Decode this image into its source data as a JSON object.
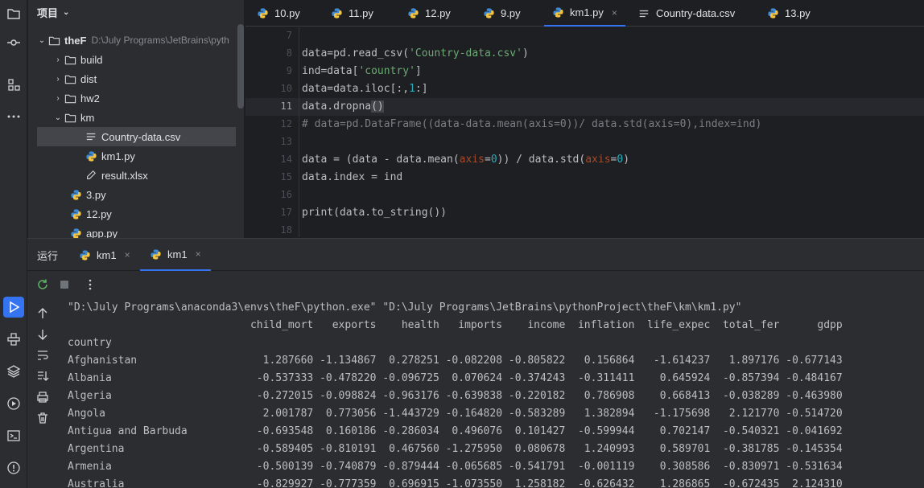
{
  "project_panel": {
    "title": "项目",
    "root": {
      "name": "theF",
      "path": "D:\\July Programs\\JetBrains\\pyth"
    },
    "items": [
      {
        "label": "build",
        "kind": "folder"
      },
      {
        "label": "dist",
        "kind": "folder"
      },
      {
        "label": "hw2",
        "kind": "folder"
      },
      {
        "label": "km",
        "kind": "folder-open"
      },
      {
        "label": "Country-data.csv",
        "kind": "csv"
      },
      {
        "label": "km1.py",
        "kind": "py"
      },
      {
        "label": "result.xlsx",
        "kind": "xlsx"
      },
      {
        "label": "3.py",
        "kind": "py"
      },
      {
        "label": "12.py",
        "kind": "py"
      },
      {
        "label": "app.py",
        "kind": "py"
      }
    ]
  },
  "editor_tabs": [
    {
      "label": "10.py",
      "kind": "py"
    },
    {
      "label": "11.py",
      "kind": "py"
    },
    {
      "label": "12.py",
      "kind": "py"
    },
    {
      "label": "9.py",
      "kind": "py"
    },
    {
      "label": "km1.py",
      "kind": "py",
      "close": "×"
    },
    {
      "label": "Country-data.csv",
      "kind": "csv"
    },
    {
      "label": "13.py",
      "kind": "py"
    }
  ],
  "editor": {
    "line_numbers": [
      "7",
      "8",
      "9",
      "10",
      "11",
      "12",
      "13",
      "14",
      "15",
      "16",
      "17",
      "18"
    ],
    "current_line": "11",
    "lines": [
      {
        "text": ""
      },
      {
        "p1": "data=pd.read_csv(",
        "s": "'Country-data.csv'",
        "p2": ")"
      },
      {
        "p1": "ind=data[",
        "s": "'country'",
        "p2": "]"
      },
      {
        "p1": "data=data.iloc[:,",
        "n": "1",
        "p2": ":]"
      },
      {
        "p1": "data.dropna",
        "b": "()"
      },
      {
        "c": "# data=pd.DataFrame((data-data.mean(axis=0))/ data.std(axis=0),index=ind)"
      },
      {
        "text": ""
      },
      {
        "p1": "data = (data - data.mean(",
        "k1": "axis",
        "e1": "=",
        "n1": "0",
        "p2": ")) / data.std(",
        "k2": "axis",
        "e2": "=",
        "n2": "0",
        "p3": ")"
      },
      {
        "text": "data.index = ind"
      },
      {
        "text": ""
      },
      {
        "text": "print(data.to_string())"
      },
      {
        "text": ""
      }
    ]
  },
  "run_panel": {
    "title": "运行",
    "tabs": [
      {
        "label": "km1",
        "close": "×"
      },
      {
        "label": "km1",
        "close": "×"
      }
    ],
    "console_lines": [
      "\"D:\\July Programs\\anaconda3\\envs\\theF\\python.exe\" \"D:\\July Programs\\JetBrains\\pythonProject\\theF\\km\\km1.py\"",
      "                             child_mort   exports    health   imports    income  inflation  life_expec  total_fer      gdpp",
      "country",
      "Afghanistan                    1.287660 -1.134867  0.278251 -0.082208 -0.805822   0.156864   -1.614237   1.897176 -0.677143",
      "Albania                       -0.537333 -0.478220 -0.096725  0.070624 -0.374243  -0.311411    0.645924  -0.857394 -0.484167",
      "Algeria                       -0.272015 -0.098824 -0.963176 -0.639838 -0.220182   0.786908    0.668413  -0.038289 -0.463980",
      "Angola                         2.001787  0.773056 -1.443729 -0.164820 -0.583289   1.382894   -1.175698   2.121770 -0.514720",
      "Antigua and Barbuda           -0.693548  0.160186 -0.286034  0.496076  0.101427  -0.599944    0.702147  -0.540321 -0.041692",
      "Argentina                     -0.589405 -0.810191  0.467560 -1.275950  0.080678   1.240993    0.589701  -0.381785 -0.145354",
      "Armenia                       -0.500139 -0.740879 -0.879444 -0.065685 -0.541791  -0.001119    0.308586  -0.830971 -0.531634",
      "Australia                     -0.829927 -0.777359  0.696915 -1.073550  1.258182  -0.626432    1.286865  -0.672435  2.124310"
    ]
  },
  "colors": {
    "accent": "#3574f0",
    "string": "#6aab73",
    "number": "#2aacb8",
    "keyword_arg": "#aa4926",
    "comment": "#7a7e85"
  }
}
